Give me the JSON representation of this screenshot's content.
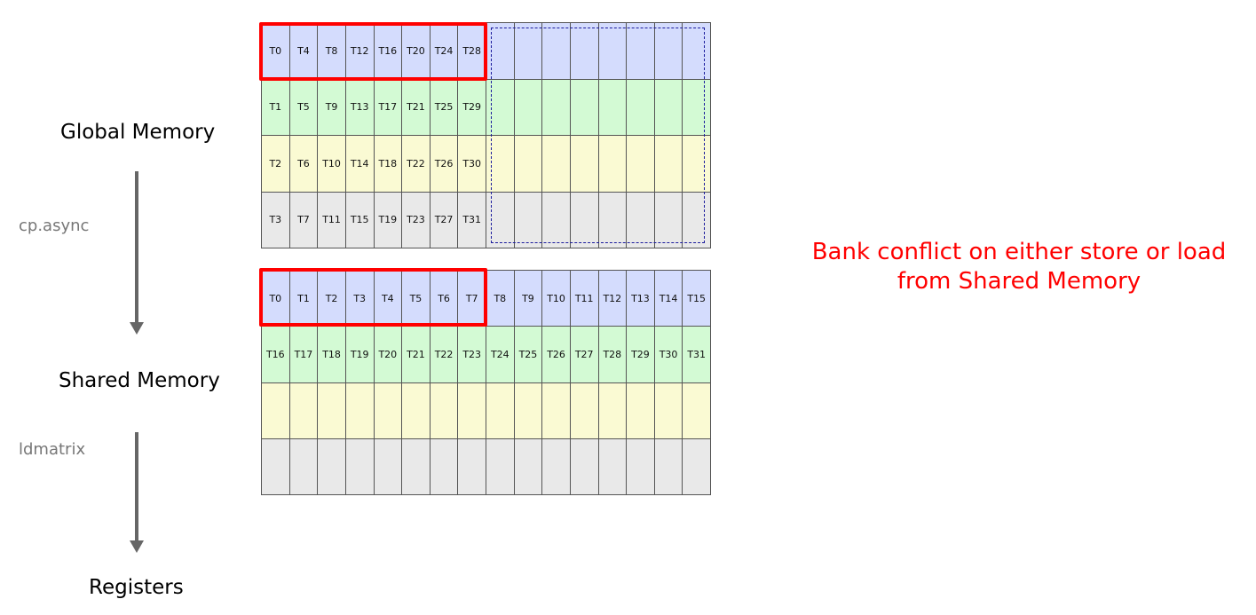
{
  "labels": {
    "global_memory": "Global Memory",
    "shared_memory": "Shared Memory",
    "registers": "Registers",
    "op_cp_async": "cp.async",
    "op_ldmatrix": "ldmatrix"
  },
  "note": {
    "line1": "Bank conflict on either store or load",
    "line2": "from Shared Memory"
  },
  "colors": {
    "row_0": "#d4dcfd",
    "row_1": "#d3fad4",
    "row_2": "#fafad3",
    "row_3": "#e9e9e9",
    "highlight": "#ff0000",
    "dashed_region": "#1a1a9c"
  },
  "global_grid": {
    "rows": [
      [
        "T0",
        "T4",
        "T8",
        "T12",
        "T16",
        "T20",
        "T24",
        "T28",
        "",
        "",
        "",
        "",
        "",
        "",
        "",
        ""
      ],
      [
        "T1",
        "T5",
        "T9",
        "T13",
        "T17",
        "T21",
        "T25",
        "T29",
        "",
        "",
        "",
        "",
        "",
        "",
        "",
        ""
      ],
      [
        "T2",
        "T6",
        "T10",
        "T14",
        "T18",
        "T22",
        "T26",
        "T30",
        "",
        "",
        "",
        "",
        "",
        "",
        "",
        ""
      ],
      [
        "T3",
        "T7",
        "T11",
        "T15",
        "T19",
        "T23",
        "T27",
        "T31",
        "",
        "",
        "",
        "",
        "",
        "",
        "",
        ""
      ]
    ]
  },
  "shared_grid": {
    "rows": [
      [
        "T0",
        "T1",
        "T2",
        "T3",
        "T4",
        "T5",
        "T6",
        "T7",
        "T8",
        "T9",
        "T10",
        "T11",
        "T12",
        "T13",
        "T14",
        "T15"
      ],
      [
        "T16",
        "T17",
        "T18",
        "T19",
        "T20",
        "T21",
        "T22",
        "T23",
        "T24",
        "T25",
        "T26",
        "T27",
        "T28",
        "T29",
        "T30",
        "T31"
      ],
      [
        "",
        "",
        "",
        "",
        "",
        "",
        "",
        "",
        "",
        "",
        "",
        "",
        "",
        "",
        "",
        ""
      ],
      [
        "",
        "",
        "",
        "",
        "",
        "",
        "",
        "",
        "",
        "",
        "",
        "",
        "",
        "",
        "",
        ""
      ]
    ]
  }
}
